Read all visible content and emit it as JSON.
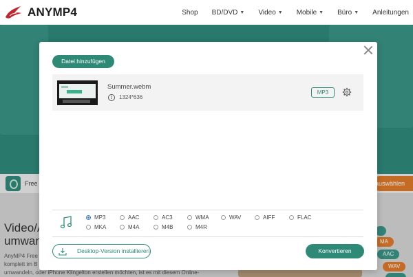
{
  "header": {
    "logo_text": "ANYMP4",
    "nav": [
      "Shop",
      "BD/DVD",
      "Video",
      "Mobile",
      "Büro",
      "Anleitungen"
    ]
  },
  "background": {
    "strip_text": "Free C",
    "strip_button": "auswählen",
    "title_line1": "Video/A",
    "title_line2": "umwand",
    "desc_line1": "AnyMP4 Free C",
    "desc_line2": "komplett im B",
    "desc_line3": "umwandeln, oder iPhone Klingelton erstellen möchten, ist es mit diesem Online-",
    "format_tags": [
      "",
      "MA",
      "AAC",
      "WAV",
      ""
    ]
  },
  "modal": {
    "add_file_label": "Datei hinzufügen",
    "file": {
      "name": "Summer.webm",
      "resolution": "1324*636",
      "format": "MP3"
    },
    "formats_row1": [
      "MP3",
      "AAC",
      "AC3",
      "WMA",
      "WAV",
      "AIFF",
      "FLAC"
    ],
    "formats_row2": [
      "MKA",
      "M4A",
      "M4B",
      "M4R"
    ],
    "selected_format": "MP3",
    "desktop_button_label": "Desktop-Version installieren",
    "convert_button_label": "Konvertieren"
  },
  "colors": {
    "accent": "#2e8a77",
    "hero": "#2f8a7c",
    "orange": "#e07b2b"
  },
  "icons": [
    "logo-bird-icon",
    "chevron-down-icon",
    "close-icon",
    "info-icon",
    "gear-icon",
    "music-note-icon",
    "download-icon"
  ]
}
